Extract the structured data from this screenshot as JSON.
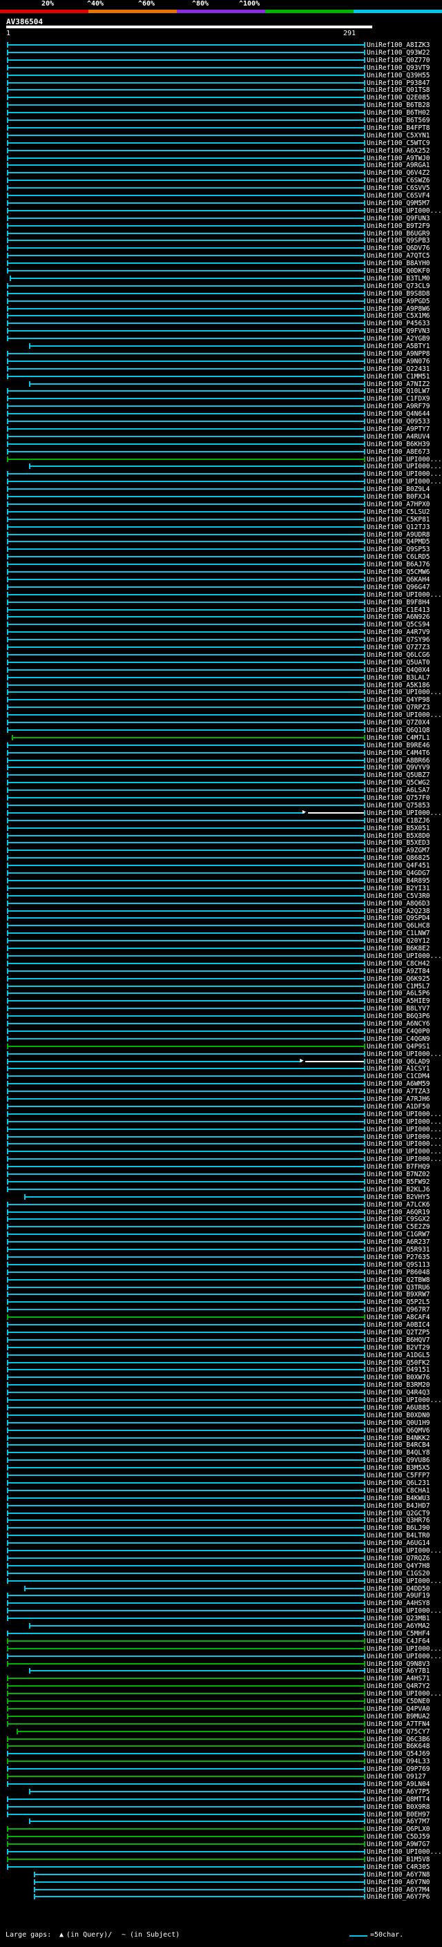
{
  "color_key": {
    "labels": [
      "20%",
      "^40%",
      "^60%",
      "^80%",
      "^100%"
    ],
    "colors": [
      "#e60000",
      "#e67300",
      "#8a2be2",
      "#00b400",
      "#00c8e6"
    ]
  },
  "query": {
    "id": "AV386504",
    "ruler_start": "1",
    "ruler_end": "291",
    "length": 291
  },
  "hits": [
    {
      "label": "UniRef100_A8IZK3",
      "color": "#00c8e6"
    },
    {
      "label": "UniRef100_Q93W22",
      "color": "#00c8e6"
    },
    {
      "label": "UniRef100_Q0Z770",
      "color": "#00c8e6"
    },
    {
      "label": "UniRef100_Q93VT9",
      "color": "#00c8e6"
    },
    {
      "label": "UniRef100_Q39H55",
      "color": "#00c8e6"
    },
    {
      "label": "UniRef100_P93847",
      "color": "#00c8e6"
    },
    {
      "label": "UniRef100_Q01TS8",
      "color": "#00c8e6"
    },
    {
      "label": "UniRef100_Q2E085",
      "color": "#00c8e6"
    },
    {
      "label": "UniRef100_B6TB28",
      "color": "#00c8e6"
    },
    {
      "label": "UniRef100_B6TH02",
      "color": "#00c8e6"
    },
    {
      "label": "UniRef100_B6T569",
      "color": "#00c8e6"
    },
    {
      "label": "UniRef100_B4FPT8",
      "color": "#00c8e6"
    },
    {
      "label": "UniRef100_C5XYN1",
      "color": "#00c8e6"
    },
    {
      "label": "UniRef100_C5WTC9",
      "color": "#00c8e6"
    },
    {
      "label": "UniRef100_A6X252",
      "color": "#00c8e6"
    },
    {
      "label": "UniRef100_A9TWJ0",
      "color": "#00c8e6"
    },
    {
      "label": "UniRef100_A9RGA1",
      "color": "#00c8e6"
    },
    {
      "label": "UniRef100_Q6V4Z2",
      "color": "#00c8e6"
    },
    {
      "label": "UniRef100_C6SWZ6",
      "color": "#00c8e6"
    },
    {
      "label": "UniRef100_C6SVV5",
      "color": "#00c8e6"
    },
    {
      "label": "UniRef100_C6SVF4",
      "color": "#00c8e6"
    },
    {
      "label": "UniRef100_Q9M5M7",
      "color": "#00c8e6"
    },
    {
      "label": "UniRef100_UPI000...",
      "color": "#00c8e6"
    },
    {
      "label": "UniRef100_Q9FUN3",
      "color": "#00c8e6"
    },
    {
      "label": "UniRef100_B9T2F9",
      "color": "#00c8e6"
    },
    {
      "label": "UniRef100_B6UGR9",
      "color": "#00c8e6"
    },
    {
      "label": "UniRef100_Q9SPB3",
      "color": "#00c8e6"
    },
    {
      "label": "UniRef100_Q6DV76",
      "color": "#00c8e6"
    },
    {
      "label": "UniRef100_A7QTC5",
      "color": "#00c8e6"
    },
    {
      "label": "UniRef100_B8AYH0",
      "color": "#00c8e6"
    },
    {
      "label": "UniRef100_Q0DKF0",
      "color": "#00c8e6"
    },
    {
      "label": "UniRef100_B3TLM0",
      "color": "#00c8e6",
      "start": 2
    },
    {
      "label": "UniRef100_Q73CL9",
      "color": "#00c8e6"
    },
    {
      "label": "UniRef100_B9S8D8",
      "color": "#00c8e6"
    },
    {
      "label": "UniRef100_A9PGD5",
      "color": "#00c8e6"
    },
    {
      "label": "UniRef100_A9P8W6",
      "color": "#00c8e6"
    },
    {
      "label": "UniRef100_C5X1M6",
      "color": "#00c8e6"
    },
    {
      "label": "UniRef100_P45633",
      "color": "#00c8e6"
    },
    {
      "label": "UniRef100_Q9FVN3",
      "color": "#00c8e6"
    },
    {
      "label": "UniRef100_A2YGB9",
      "color": "#00c8e6"
    },
    {
      "label": "UniRef100_A5BTY1",
      "color": "#00c8e6",
      "start": 18
    },
    {
      "label": "UniRef100_A9NPP8",
      "color": "#00c8e6"
    },
    {
      "label": "UniRef100_A9N076",
      "color": "#00c8e6"
    },
    {
      "label": "UniRef100_Q22431",
      "color": "#00c8e6"
    },
    {
      "label": "UniRef100_C1MM51",
      "color": "#00c8e6"
    },
    {
      "label": "UniRef100_A7NIZ2",
      "color": "#00c8e6",
      "start": 18
    },
    {
      "label": "UniRef100_Q10LW7",
      "color": "#00c8e6"
    },
    {
      "label": "UniRef100_C1FDX9",
      "color": "#00c8e6"
    },
    {
      "label": "UniRef100_A9RF79",
      "color": "#00c8e6"
    },
    {
      "label": "UniRef100_Q4N644",
      "color": "#00c8e6"
    },
    {
      "label": "UniRef100_Q09533",
      "color": "#00c8e6"
    },
    {
      "label": "UniRef100_A9PTY7",
      "color": "#00c8e6"
    },
    {
      "label": "UniRef100_A4RUV4",
      "color": "#00c8e6"
    },
    {
      "label": "UniRef100_B6KH39",
      "color": "#00c8e6"
    },
    {
      "label": "UniRef100_A8E673",
      "color": "#00c8e6"
    },
    {
      "label": "UniRef100_UPI000...",
      "color": "#00b400",
      "start": 0
    },
    {
      "label": "UniRef100_UPI000...",
      "color": "#00c8e6",
      "start": 18
    },
    {
      "label": "UniRef100_UPI000...",
      "color": "#00c8e6"
    },
    {
      "label": "UniRef100_UPI000...",
      "color": "#00c8e6"
    },
    {
      "label": "UniRef100_B0Z9L4",
      "color": "#00c8e6"
    },
    {
      "label": "UniRef100_B0FXJ4",
      "color": "#00c8e6"
    },
    {
      "label": "UniRef100_A7HPX0",
      "color": "#00c8e6"
    },
    {
      "label": "UniRef100_C5LSU2",
      "color": "#00c8e6"
    },
    {
      "label": "UniRef100_C5KP81",
      "color": "#00c8e6"
    },
    {
      "label": "UniRef100_Q12TJ3",
      "color": "#00c8e6"
    },
    {
      "label": "UniRef100_A9UDR8",
      "color": "#00c8e6"
    },
    {
      "label": "UniRef100_Q4PMD5",
      "color": "#00c8e6"
    },
    {
      "label": "UniRef100_Q9SP53",
      "color": "#00c8e6"
    },
    {
      "label": "UniRef100_C6LRD5",
      "color": "#00c8e6"
    },
    {
      "label": "UniRef100_B6AJ76",
      "color": "#00c8e6"
    },
    {
      "label": "UniRef100_Q5CMW6",
      "color": "#00c8e6"
    },
    {
      "label": "UniRef100_Q6KAH4",
      "color": "#00c8e6"
    },
    {
      "label": "UniRef100_Q96G47",
      "color": "#00c8e6"
    },
    {
      "label": "UniRef100_UPI000...",
      "color": "#00c8e6"
    },
    {
      "label": "UniRef100_B9F8H4",
      "color": "#00c8e6"
    },
    {
      "label": "UniRef100_C1E413",
      "color": "#00c8e6"
    },
    {
      "label": "UniRef100_A6N926",
      "color": "#00c8e6"
    },
    {
      "label": "UniRef100_Q5CS94",
      "color": "#00c8e6"
    },
    {
      "label": "UniRef100_A4R7V9",
      "color": "#00c8e6"
    },
    {
      "label": "UniRef100_Q7SY96",
      "color": "#00c8e6"
    },
    {
      "label": "UniRef100_Q7Z7Z3",
      "color": "#00c8e6"
    },
    {
      "label": "UniRef100_Q6LCG6",
      "color": "#00c8e6"
    },
    {
      "label": "UniRef100_Q5UAT0",
      "color": "#00c8e6"
    },
    {
      "label": "UniRef100_Q4Q0X4",
      "color": "#00c8e6"
    },
    {
      "label": "UniRef100_B3LAL7",
      "color": "#00c8e6"
    },
    {
      "label": "UniRef100_A5K186",
      "color": "#00c8e6"
    },
    {
      "label": "UniRef100_UPI000...",
      "color": "#00c8e6"
    },
    {
      "label": "UniRef100_Q4YP98",
      "color": "#00c8e6"
    },
    {
      "label": "UniRef100_Q7RPZ3",
      "color": "#00c8e6"
    },
    {
      "label": "UniRef100_UPI000...",
      "color": "#00c8e6"
    },
    {
      "label": "UniRef100_Q7Z0X4",
      "color": "#00c8e6"
    },
    {
      "label": "UniRef100_Q6Q1Q8",
      "color": "#00c8e6"
    },
    {
      "label": "UniRef100_C4M7L1",
      "color": "#00b400",
      "start": 4
    },
    {
      "label": "UniRef100_B9RE46",
      "color": "#00c8e6"
    },
    {
      "label": "UniRef100_C4M4T6",
      "color": "#00c8e6"
    },
    {
      "label": "UniRef100_A8BR66",
      "color": "#00c8e6"
    },
    {
      "label": "UniRef100_Q9VYV9",
      "color": "#00c8e6"
    },
    {
      "label": "UniRef100_Q5UBZ7",
      "color": "#00c8e6"
    },
    {
      "label": "UniRef100_Q5CWG2",
      "color": "#00c8e6"
    },
    {
      "label": "UniRef100_A6LSA7",
      "color": "#00c8e6"
    },
    {
      "label": "UniRef100_Q757F0",
      "color": "#00c8e6"
    },
    {
      "label": "UniRef100_Q75853",
      "color": "#00c8e6"
    },
    {
      "label": "UniRef100_UPI000...",
      "color": "#00c8e6",
      "end": 242,
      "arrow": true
    },
    {
      "label": "UniRef100_C1BZJ6",
      "color": "#00c8e6"
    },
    {
      "label": "UniRef100_B5X051",
      "color": "#00c8e6"
    },
    {
      "label": "UniRef100_B5X8D0",
      "color": "#00c8e6"
    },
    {
      "label": "UniRef100_B5XED3",
      "color": "#00c8e6"
    },
    {
      "label": "UniRef100_A9ZGM7",
      "color": "#00c8e6"
    },
    {
      "label": "UniRef100_Q86825",
      "color": "#00c8e6"
    },
    {
      "label": "UniRef100_Q4F451",
      "color": "#00c8e6"
    },
    {
      "label": "UniRef100_Q4GDG7",
      "color": "#00c8e6"
    },
    {
      "label": "UniRef100_B4R895",
      "color": "#00c8e6"
    },
    {
      "label": "UniRef100_B2YI31",
      "color": "#00c8e6"
    },
    {
      "label": "UniRef100_C5V3R0",
      "color": "#00c8e6"
    },
    {
      "label": "UniRef100_A8Q6D3",
      "color": "#00c8e6"
    },
    {
      "label": "UniRef100_A2Q238",
      "color": "#00c8e6"
    },
    {
      "label": "UniRef100_Q9SPD4",
      "color": "#00c8e6"
    },
    {
      "label": "UniRef100_Q6LHC8",
      "color": "#00c8e6"
    },
    {
      "label": "UniRef100_C1LNW7",
      "color": "#00c8e6"
    },
    {
      "label": "UniRef100_Q20Y12",
      "color": "#00c8e6"
    },
    {
      "label": "UniRef100_B6K8E2",
      "color": "#00c8e6"
    },
    {
      "label": "UniRef100_UPI000...",
      "color": "#00c8e6"
    },
    {
      "label": "UniRef100_C8CH42",
      "color": "#00c8e6"
    },
    {
      "label": "UniRef100_A9ZT84",
      "color": "#00c8e6"
    },
    {
      "label": "UniRef100_Q6K925",
      "color": "#00c8e6"
    },
    {
      "label": "UniRef100_C1M5L7",
      "color": "#00c8e6"
    },
    {
      "label": "UniRef100_A6L5P6",
      "color": "#00c8e6"
    },
    {
      "label": "UniRef100_A5HIE9",
      "color": "#00c8e6"
    },
    {
      "label": "UniRef100_B8LYV7",
      "color": "#00c8e6"
    },
    {
      "label": "UniRef100_B6Q3P6",
      "color": "#00c8e6"
    },
    {
      "label": "UniRef100_A6NCY6",
      "color": "#00c8e6"
    },
    {
      "label": "UniRef100_C4Q0P0",
      "color": "#00c8e6"
    },
    {
      "label": "UniRef100_C4QGN9",
      "color": "#00c8e6"
    },
    {
      "label": "UniRef100_Q4P9S1",
      "color": "#00b400",
      "start": 0
    },
    {
      "label": "UniRef100_UPI000...",
      "color": "#00c8e6"
    },
    {
      "label": "UniRef100_Q6LAD9",
      "color": "#00c8e6",
      "end": 240,
      "arrow": true
    },
    {
      "label": "UniRef100_A1CSY1",
      "color": "#00c8e6"
    },
    {
      "label": "UniRef100_C1CDM4",
      "color": "#00c8e6"
    },
    {
      "label": "UniRef100_A6WM59",
      "color": "#00c8e6"
    },
    {
      "label": "UniRef100_A7TZA3",
      "color": "#00c8e6"
    },
    {
      "label": "UniRef100_A7RJH6",
      "color": "#00c8e6"
    },
    {
      "label": "UniRef100_A1DF50",
      "color": "#00c8e6"
    },
    {
      "label": "UniRef100_UPI000...",
      "color": "#00c8e6"
    },
    {
      "label": "UniRef100_UPI000...",
      "color": "#00c8e6"
    },
    {
      "label": "UniRef100_UPI000...",
      "color": "#00c8e6"
    },
    {
      "label": "UniRef100_UPI000...",
      "color": "#00c8e6"
    },
    {
      "label": "UniRef100_UPI000...",
      "color": "#00c8e6"
    },
    {
      "label": "UniRef100_UPI000...",
      "color": "#00c8e6"
    },
    {
      "label": "UniRef100_UPI000...",
      "color": "#00c8e6"
    },
    {
      "label": "UniRef100_B7FHQ9",
      "color": "#00c8e6"
    },
    {
      "label": "UniRef100_B7NZ02",
      "color": "#00c8e6"
    },
    {
      "label": "UniRef100_B5FW92",
      "color": "#00c8e6"
    },
    {
      "label": "UniRef100_B2KLJ6",
      "color": "#00c8e6"
    },
    {
      "label": "UniRef100_B2VHY5",
      "color": "#00c8e6",
      "start": 14
    },
    {
      "label": "UniRef100_A7LCK6",
      "color": "#00c8e6"
    },
    {
      "label": "UniRef100_A6QR19",
      "color": "#00c8e6"
    },
    {
      "label": "UniRef100_C9SGX2",
      "color": "#00c8e6"
    },
    {
      "label": "UniRef100_C5E2Z9",
      "color": "#00c8e6"
    },
    {
      "label": "UniRef100_C1GRW7",
      "color": "#00c8e6"
    },
    {
      "label": "UniRef100_A6R237",
      "color": "#00c8e6"
    },
    {
      "label": "UniRef100_Q5R931",
      "color": "#00c8e6"
    },
    {
      "label": "UniRef100_P27635",
      "color": "#00c8e6"
    },
    {
      "label": "UniRef100_Q9S113",
      "color": "#00c8e6"
    },
    {
      "label": "UniRef100_P86048",
      "color": "#00c8e6"
    },
    {
      "label": "UniRef100_Q2TBW8",
      "color": "#00c8e6"
    },
    {
      "label": "UniRef100_Q3TRU6",
      "color": "#00c8e6"
    },
    {
      "label": "UniRef100_B9XRW7",
      "color": "#00c8e6"
    },
    {
      "label": "UniRef100_Q5P2L5",
      "color": "#00c8e6"
    },
    {
      "label": "UniRef100_Q967R7",
      "color": "#00c8e6"
    },
    {
      "label": "UniRef100_A8CAF4",
      "color": "#00b400"
    },
    {
      "label": "UniRef100_A0BIC4",
      "color": "#00c8e6"
    },
    {
      "label": "UniRef100_Q2TZP5",
      "color": "#00c8e6"
    },
    {
      "label": "UniRef100_B6HQV7",
      "color": "#00c8e6"
    },
    {
      "label": "UniRef100_B2VT29",
      "color": "#00c8e6"
    },
    {
      "label": "UniRef100_A1DGL5",
      "color": "#00c8e6"
    },
    {
      "label": "UniRef100_Q50FK2",
      "color": "#00c8e6"
    },
    {
      "label": "UniRef100_O49151",
      "color": "#00c8e6"
    },
    {
      "label": "UniRef100_B0XW76",
      "color": "#00c8e6"
    },
    {
      "label": "UniRef100_B3RM20",
      "color": "#00c8e6"
    },
    {
      "label": "UniRef100_Q4R4Q3",
      "color": "#00c8e6"
    },
    {
      "label": "UniRef100_UPI000...",
      "color": "#00c8e6"
    },
    {
      "label": "UniRef100_A6U885",
      "color": "#00c8e6"
    },
    {
      "label": "UniRef100_B0XDN0",
      "color": "#00c8e6"
    },
    {
      "label": "UniRef100_Q0U1H9",
      "color": "#00c8e6"
    },
    {
      "label": "UniRef100_Q6QMV6",
      "color": "#00c8e6"
    },
    {
      "label": "UniRef100_B4NKK2",
      "color": "#00c8e6"
    },
    {
      "label": "UniRef100_B4RCB4",
      "color": "#00c8e6"
    },
    {
      "label": "UniRef100_B4QLY8",
      "color": "#00c8e6"
    },
    {
      "label": "UniRef100_Q9VU86",
      "color": "#00c8e6"
    },
    {
      "label": "UniRef100_B3M5X5",
      "color": "#00c8e6"
    },
    {
      "label": "UniRef100_C5FFP7",
      "color": "#00c8e6"
    },
    {
      "label": "UniRef100_Q6L231",
      "color": "#00c8e6"
    },
    {
      "label": "UniRef100_C8CHA1",
      "color": "#00c8e6"
    },
    {
      "label": "UniRef100_B4KWU3",
      "color": "#00c8e6"
    },
    {
      "label": "UniRef100_B4JHD7",
      "color": "#00c8e6"
    },
    {
      "label": "UniRef100_Q2GCT9",
      "color": "#00c8e6"
    },
    {
      "label": "UniRef100_Q3HR76",
      "color": "#00c8e6"
    },
    {
      "label": "UniRef100_B6LJ90",
      "color": "#00c8e6"
    },
    {
      "label": "UniRef100_B4LTR0",
      "color": "#00c8e6"
    },
    {
      "label": "UniRef100_A6UG14",
      "color": "#00c8e6"
    },
    {
      "label": "UniRef100_UPI000...",
      "color": "#00c8e6"
    },
    {
      "label": "UniRef100_Q7RQZ6",
      "color": "#00c8e6"
    },
    {
      "label": "UniRef100_Q4Y7H8",
      "color": "#00c8e6"
    },
    {
      "label": "UniRef100_C1GS20",
      "color": "#00c8e6"
    },
    {
      "label": "UniRef100_UPI000...",
      "color": "#00c8e6"
    },
    {
      "label": "UniRef100_Q4DD50",
      "color": "#00c8e6",
      "start": 14
    },
    {
      "label": "UniRef100_A9UF19",
      "color": "#00c8e6"
    },
    {
      "label": "UniRef100_A4HSY8",
      "color": "#00c8e6"
    },
    {
      "label": "UniRef100_UPI000...",
      "color": "#00c8e6"
    },
    {
      "label": "UniRef100_Q23MB1",
      "color": "#00c8e6"
    },
    {
      "label": "UniRef100_A6YMA2",
      "color": "#00c8e6",
      "start": 18
    },
    {
      "label": "UniRef100_C5MHF4",
      "color": "#00c8e6"
    },
    {
      "label": "UniRef100_C4JF64",
      "color": "#00b400"
    },
    {
      "label": "UniRef100_UPI000...",
      "color": "#00b400"
    },
    {
      "label": "UniRef100_UPI000...",
      "color": "#00c8e6"
    },
    {
      "label": "UniRef100_Q9N8V3",
      "color": "#00b400"
    },
    {
      "label": "UniRef100_A6Y7B1",
      "color": "#00c8e6",
      "start": 18
    },
    {
      "label": "UniRef100_A4HS71",
      "color": "#00b400"
    },
    {
      "label": "UniRef100_Q4R7Y2",
      "color": "#00b400"
    },
    {
      "label": "UniRef100_UPI000...",
      "color": "#00b400"
    },
    {
      "label": "UniRef100_C5DNE0",
      "color": "#00b400"
    },
    {
      "label": "UniRef100_Q4PVA0",
      "color": "#00b400"
    },
    {
      "label": "UniRef100_B9MUA2",
      "color": "#00b400"
    },
    {
      "label": "UniRef100_A7TFN4",
      "color": "#00b400"
    },
    {
      "label": "UniRef100_Q75CY7",
      "color": "#00b400",
      "start": 8
    },
    {
      "label": "UniRef100_Q6C3B6",
      "color": "#00b400"
    },
    {
      "label": "UniRef100_B6K648",
      "color": "#00b400"
    },
    {
      "label": "UniRef100_Q54J69",
      "color": "#00c8e6"
    },
    {
      "label": "UniRef100_O94L33",
      "color": "#00b400"
    },
    {
      "label": "UniRef100_Q9P769",
      "color": "#00c8e6"
    },
    {
      "label": "UniRef100_O9127",
      "color": "#00b400"
    },
    {
      "label": "UniRef100_A9LN04",
      "color": "#00c8e6"
    },
    {
      "label": "UniRef100_A6Y7P5",
      "color": "#00c8e6",
      "start": 18
    },
    {
      "label": "UniRef100_Q8MTT4",
      "color": "#00c8e6"
    },
    {
      "label": "UniRef100_B0X9R8",
      "color": "#00c8e6"
    },
    {
      "label": "UniRef100_B0EH97",
      "color": "#00c8e6"
    },
    {
      "label": "UniRef100_A6Y7M7",
      "color": "#00c8e6",
      "start": 18
    },
    {
      "label": "UniRef100_Q6PLX0",
      "color": "#00b400"
    },
    {
      "label": "UniRef100_C5DJ59",
      "color": "#00b400"
    },
    {
      "label": "UniRef100_A9W7G7",
      "color": "#00b400"
    },
    {
      "label": "UniRef100_UPI000...",
      "color": "#00c8e6"
    },
    {
      "label": "UniRef100_B1M5V8",
      "color": "#00b400"
    },
    {
      "label": "UniRef100_C4R305",
      "color": "#00c8e6"
    },
    {
      "label": "UniRef100_A6Y7N8",
      "color": "#00c8e6",
      "start": 22
    },
    {
      "label": "UniRef100_A6Y7N0",
      "color": "#00c8e6",
      "start": 22
    },
    {
      "label": "UniRef100_A6Y7M4",
      "color": "#00c8e6",
      "start": 22
    },
    {
      "label": "UniRef100_A6Y7P6",
      "color": "#00c8e6",
      "start": 22
    }
  ],
  "footer": {
    "gaps_label": "Large gaps:",
    "in_query": "(in Query)/",
    "in_subject": "(in Subject)",
    "legend_text": "=50char."
  }
}
